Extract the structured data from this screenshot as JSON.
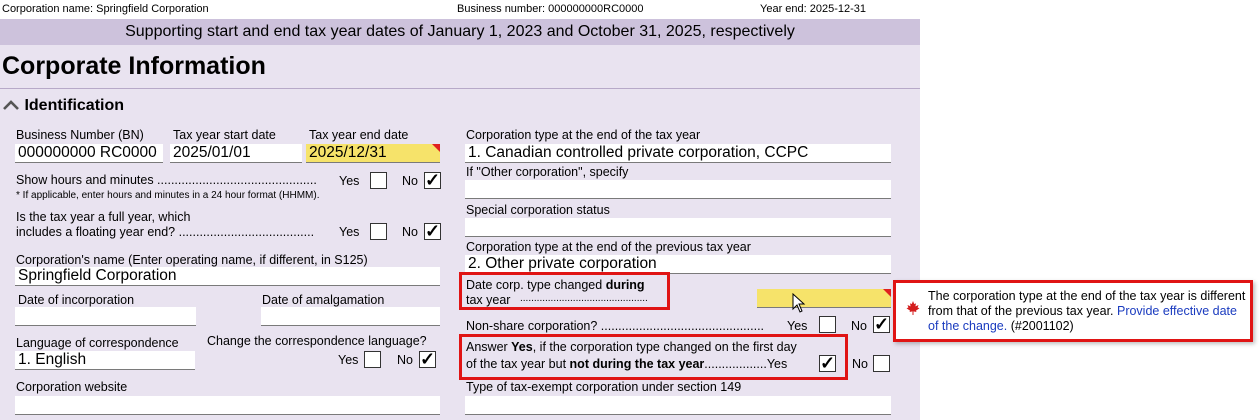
{
  "header": {
    "corp_name": "Corporation name: Springfield Corporation",
    "business_number": "Business number: 000000000RC0000",
    "year_end": "Year end: 2025-12-31"
  },
  "banner": "Supporting start and end tax year dates of January 1, 2023 and October 31, 2025, respectively",
  "page_title": "Corporate Information",
  "section": {
    "title": "Identification",
    "icon": "chevron-up-icon"
  },
  "left": {
    "bn_label": "Business Number (BN)",
    "bn_value": "000000000 RC0000",
    "start_label": "Tax year start date",
    "start_value": "2025/01/01",
    "end_label": "Tax year end date",
    "end_value": "2025/12/31",
    "hours_label": "Show hours and minutes ..............................................",
    "hours_note": "* If applicable, enter hours and minutes in a 24 hour format (HHMM).",
    "full_year_label1": "Is the tax year a full year, which",
    "full_year_label2": "includes a floating year end? .......................................",
    "name_label": "Corporation's name (Enter operating name, if different, in S125)",
    "name_value": "Springfield Corporation",
    "incorp_label": "Date of incorporation",
    "amalg_label": "Date of amalgamation",
    "lang_label": "Language of correspondence",
    "lang_value": "1. English",
    "change_lang_label": "Change the correspondence language?",
    "website_label": "Corporation website",
    "yes": "Yes",
    "no": "No",
    "check": "✓"
  },
  "right": {
    "type_end_label": "Corporation type at the end of the tax year",
    "type_end_value": "1. Canadian controlled private corporation, CCPC",
    "other_label": "If \"Other corporation\", specify",
    "special_label": "Special corporation status",
    "type_prev_label": "Corporation type at the end of the previous tax year",
    "type_prev_value": "2. Other private corporation",
    "changed_label_a": "Date corp. type changed ",
    "changed_label_b": "during",
    "changed_label_c": "tax year",
    "changed_dots": "..............................................",
    "nonshare_label": "Non-share corporation?  ...............................................",
    "answer_a": "Answer ",
    "answer_b": "Yes",
    "answer_c": ", if the corporation type changed on the first day",
    "answer_d": "of the tax year but ",
    "answer_e": "not during the tax year",
    "answer_f": "..................",
    "exempt_label": "Type of tax-exempt corporation under section 149"
  },
  "tooltip": {
    "text": "The corporation type at the end of the tax year is different from that of the previous tax year. ",
    "link": "Provide effective date of the change.",
    "code": " (#2001102)",
    "icon": "maple-leaf-icon"
  },
  "colors": {
    "form_bg": "#e9e3f0",
    "banner_bg": "#cdc2dc",
    "highlight": "#f6e36a",
    "alert_red": "#e01414",
    "link": "#1a3bbf"
  }
}
